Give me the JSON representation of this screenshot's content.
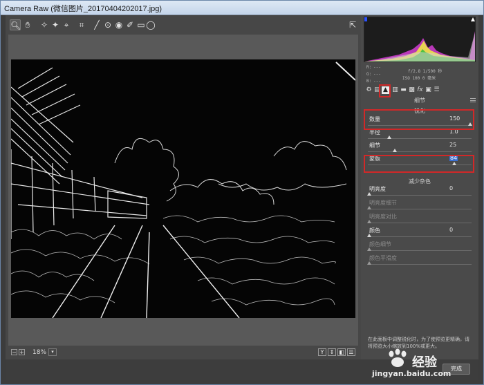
{
  "window": {
    "title": "Camera Raw (微信图片_20170404202017.jpg)"
  },
  "toolbar": {
    "tools": [
      "zoom-icon",
      "hand-icon",
      "white-balance-icon",
      "color-sampler-icon",
      "target-adjust-icon",
      "crop-icon",
      "straighten-icon",
      "spot-removal-icon",
      "red-eye-icon",
      "adjustment-brush-icon",
      "graduated-filter-icon",
      "radial-filter-icon"
    ],
    "fullscreen": "fullscreen-icon"
  },
  "camera_info": {
    "r": "R:",
    "r_val": "---",
    "g": "G:",
    "g_val": "---",
    "b": "B:",
    "b_val": "---",
    "exposure": "f/2.8   1/500 秒",
    "iso": "ISO 100   0 毫米"
  },
  "panel": {
    "tabs": [
      "basic-icon",
      "tone-curve-icon",
      "detail-icon",
      "hsl-icon",
      "split-toning-icon",
      "lens-corrections-icon",
      "effects-icon",
      "camera-calibration-icon",
      "presets-icon"
    ],
    "title": "细节",
    "sharpening": {
      "title": "锐化",
      "sliders": [
        {
          "label": "数量",
          "value": "150",
          "level": 1.0
        },
        {
          "label": "半径",
          "value": "1.0",
          "level": 0.2
        },
        {
          "label": "细节",
          "value": "25",
          "level": 0.25
        },
        {
          "label": "蒙版",
          "value": "84",
          "level": 0.84
        }
      ]
    },
    "noise": {
      "title": "减少杂色",
      "sliders": [
        {
          "label": "明亮度",
          "value": "0",
          "level": 0.0,
          "dim": false
        },
        {
          "label": "明亮度细节",
          "value": "",
          "level": 0.0,
          "dim": true
        },
        {
          "label": "明亮度对比",
          "value": "",
          "level": 0.0,
          "dim": true
        },
        {
          "label": "颜色",
          "value": "0",
          "level": 0.0,
          "dim": false
        },
        {
          "label": "颜色细节",
          "value": "",
          "level": 0.0,
          "dim": true
        },
        {
          "label": "颜色平滑度",
          "value": "",
          "level": 0.0,
          "dim": true
        }
      ]
    },
    "info_text": "在此面板中调整锐化时，为了使预览更精确，请将预览大小缩放到100%或更大。"
  },
  "statusbar": {
    "zoom": "18%",
    "zoom_out": "−",
    "zoom_in": "+",
    "view_buttons": [
      "Y",
      "⇕",
      "◧",
      "☰"
    ]
  },
  "footer": {
    "done": "完成"
  },
  "watermark": {
    "brand": "经验",
    "url": "jingyan.baidu.com"
  },
  "colors": {
    "highlight": "#d22828",
    "selection": "#3b6fd0"
  }
}
